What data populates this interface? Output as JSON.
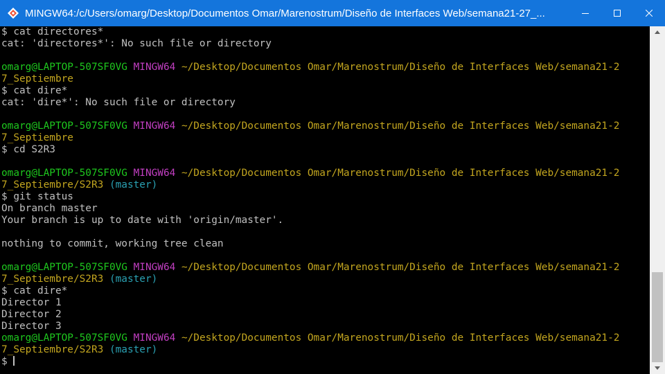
{
  "window": {
    "title": "MINGW64:/c/Users/omarg/Desktop/Documentos Omar/Marenostrum/Diseño de Interfaces Web/semana21-27_..."
  },
  "terminal": {
    "lines": [
      {
        "segments": [
          {
            "text": "$ cat directores*",
            "color": "default"
          }
        ]
      },
      {
        "segments": [
          {
            "text": "cat: 'directores*': No such file or directory",
            "color": "default"
          }
        ]
      },
      {
        "segments": [
          {
            "text": "",
            "color": "default"
          }
        ]
      },
      {
        "segments": [
          {
            "text": "omarg@LAPTOP-507SF0VG",
            "color": "green"
          },
          {
            "text": " ",
            "color": "default"
          },
          {
            "text": "MINGW64",
            "color": "magenta"
          },
          {
            "text": " ",
            "color": "default"
          },
          {
            "text": "~/Desktop/Documentos Omar/Marenostrum/Diseño de Interfaces Web/semana21-2",
            "color": "yellow"
          }
        ]
      },
      {
        "segments": [
          {
            "text": "7_Septiembre",
            "color": "yellow"
          }
        ]
      },
      {
        "segments": [
          {
            "text": "$ cat dire*",
            "color": "default"
          }
        ]
      },
      {
        "segments": [
          {
            "text": "cat: 'dire*': No such file or directory",
            "color": "default"
          }
        ]
      },
      {
        "segments": [
          {
            "text": "",
            "color": "default"
          }
        ]
      },
      {
        "segments": [
          {
            "text": "omarg@LAPTOP-507SF0VG",
            "color": "green"
          },
          {
            "text": " ",
            "color": "default"
          },
          {
            "text": "MINGW64",
            "color": "magenta"
          },
          {
            "text": " ",
            "color": "default"
          },
          {
            "text": "~/Desktop/Documentos Omar/Marenostrum/Diseño de Interfaces Web/semana21-2",
            "color": "yellow"
          }
        ]
      },
      {
        "segments": [
          {
            "text": "7_Septiembre",
            "color": "yellow"
          }
        ]
      },
      {
        "segments": [
          {
            "text": "$ cd S2R3",
            "color": "default"
          }
        ]
      },
      {
        "segments": [
          {
            "text": "",
            "color": "default"
          }
        ]
      },
      {
        "segments": [
          {
            "text": "omarg@LAPTOP-507SF0VG",
            "color": "green"
          },
          {
            "text": " ",
            "color": "default"
          },
          {
            "text": "MINGW64",
            "color": "magenta"
          },
          {
            "text": " ",
            "color": "default"
          },
          {
            "text": "~/Desktop/Documentos Omar/Marenostrum/Diseño de Interfaces Web/semana21-2",
            "color": "yellow"
          }
        ]
      },
      {
        "segments": [
          {
            "text": "7_Septiembre/S2R3",
            "color": "yellow"
          },
          {
            "text": " ",
            "color": "default"
          },
          {
            "text": "(master)",
            "color": "cyan"
          }
        ]
      },
      {
        "segments": [
          {
            "text": "$ git status",
            "color": "default"
          }
        ]
      },
      {
        "segments": [
          {
            "text": "On branch master",
            "color": "default"
          }
        ]
      },
      {
        "segments": [
          {
            "text": "Your branch is up to date with 'origin/master'.",
            "color": "default"
          }
        ]
      },
      {
        "segments": [
          {
            "text": "",
            "color": "default"
          }
        ]
      },
      {
        "segments": [
          {
            "text": "nothing to commit, working tree clean",
            "color": "default"
          }
        ]
      },
      {
        "segments": [
          {
            "text": "",
            "color": "default"
          }
        ]
      },
      {
        "segments": [
          {
            "text": "omarg@LAPTOP-507SF0VG",
            "color": "green"
          },
          {
            "text": " ",
            "color": "default"
          },
          {
            "text": "MINGW64",
            "color": "magenta"
          },
          {
            "text": " ",
            "color": "default"
          },
          {
            "text": "~/Desktop/Documentos Omar/Marenostrum/Diseño de Interfaces Web/semana21-2",
            "color": "yellow"
          }
        ]
      },
      {
        "segments": [
          {
            "text": "7_Septiembre/S2R3",
            "color": "yellow"
          },
          {
            "text": " ",
            "color": "default"
          },
          {
            "text": "(master)",
            "color": "cyan"
          }
        ]
      },
      {
        "segments": [
          {
            "text": "$ cat dire*",
            "color": "default"
          }
        ]
      },
      {
        "segments": [
          {
            "text": "Director 1",
            "color": "default"
          }
        ]
      },
      {
        "segments": [
          {
            "text": "Director 2",
            "color": "default"
          }
        ]
      },
      {
        "segments": [
          {
            "text": "Director 3",
            "color": "default"
          }
        ]
      },
      {
        "segments": [
          {
            "text": "omarg@LAPTOP-507SF0VG",
            "color": "green"
          },
          {
            "text": " ",
            "color": "default"
          },
          {
            "text": "MINGW64",
            "color": "magenta"
          },
          {
            "text": " ",
            "color": "default"
          },
          {
            "text": "~/Desktop/Documentos Omar/Marenostrum/Diseño de Interfaces Web/semana21-2",
            "color": "yellow"
          }
        ]
      },
      {
        "segments": [
          {
            "text": "7_Septiembre/S2R3",
            "color": "yellow"
          },
          {
            "text": " ",
            "color": "default"
          },
          {
            "text": "(master)",
            "color": "cyan"
          }
        ]
      }
    ],
    "prompt": "$ ",
    "input_value": ""
  },
  "scrollbar": {
    "position_fraction": 1.0
  },
  "colors": {
    "titlebar": "#1475dc",
    "background": "#000000",
    "default": "#c0c0c0",
    "green": "#1ec81e",
    "magenta": "#c23fc2",
    "yellow": "#c3a61f",
    "cyan": "#2aa1b3"
  },
  "icons": {
    "app": "mingw-terminal-icon",
    "minimize": "minimize-icon",
    "maximize": "maximize-icon",
    "close": "close-icon",
    "scroll_up": "scroll-up-arrow-icon",
    "scroll_down": "scroll-down-arrow-icon"
  }
}
